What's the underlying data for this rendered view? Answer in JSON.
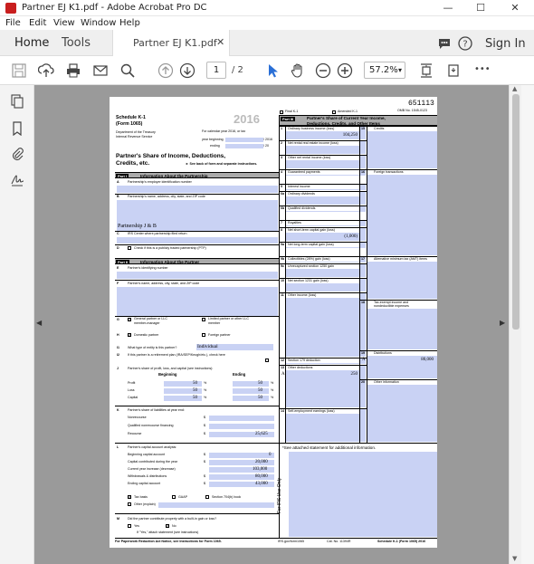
{
  "window": {
    "title": "Partner EJ K1.pdf - Adobe Acrobat Pro DC",
    "minimize": "—",
    "maximize": "☐",
    "close": "✕"
  },
  "menu": {
    "file": "File",
    "edit": "Edit",
    "view": "View",
    "window": "Window",
    "help": "Help"
  },
  "tabs": {
    "home": "Home",
    "tools": "Tools",
    "document": "Partner EJ K1.pdf",
    "document_close": "✕",
    "signin": "Sign In"
  },
  "toolbar": {
    "page_current": "1",
    "page_total": "/ 2",
    "zoom": "57.2%",
    "zoom_arrow": "▾",
    "more": "•••"
  },
  "icons": {
    "app": "acrobat-icon",
    "save": "save-icon",
    "upload": "upload-icon",
    "print": "print-icon",
    "mail": "mail-icon",
    "search": "search-icon",
    "prev": "arrow-up-icon",
    "next": "arrow-down-icon",
    "select": "cursor-icon",
    "hand": "hand-icon",
    "zoom_out": "minus-circle-icon",
    "zoom_in": "plus-circle-icon"
  },
  "form": {
    "final_k1": "Final K-1",
    "amended_k1": "Amended K-1",
    "code": "651113",
    "omb": "OMB No. 1545-0123",
    "schedule": "Schedule K-1",
    "form_num": "(Form 1065)",
    "year": "2016",
    "dept": "Department of the Treasury",
    "irs": "Internal Revenue Service",
    "cal_year": "For calendar year 2016, or tax",
    "year_beginning": "year beginning",
    "yb_suffix": "/ 2016",
    "ending": "ending",
    "end_suffix": "/ 20",
    "share_title1": "Partner's Share of Income, Deductions,",
    "share_title2": "Credits, etc.",
    "see_back": "► See back of form and separate instructions.",
    "part1_label": "Part I",
    "part1_title": "Information About the Partnership",
    "A": "A",
    "A_text": "Partnership's employer identification number",
    "B": "B",
    "B_text": "Partnership's name, address, city, state, and ZIP code",
    "B_value": "Partnership J & B",
    "C": "C",
    "C_text": "IRS Center where partnership filed return",
    "D": "D",
    "D_text": "Check if this is a publicly traded partnership (PTP)",
    "part2_label": "Part II",
    "part2_title": "Information About the Partner",
    "E": "E",
    "E_text": "Partner's identifying number",
    "F": "F",
    "F_text": "Partner's name, address, city, state, and ZIP code",
    "G": "G",
    "G_opt1a": "General partner or LLC",
    "G_opt1b": "member-manager",
    "G_opt2a": "Limited partner or other LLC",
    "G_opt2b": "member",
    "H": "H",
    "H_opt1": "Domestic partner",
    "H_opt2": "Foreign partner",
    "I1": "I1",
    "I1_text": "What type of entity is this partner?",
    "I1_value": "Individual",
    "I2": "I2",
    "I2_text": "If this partner is a retirement plan (IRA/SEP/Keogh/etc.), check here",
    "J": "J",
    "J_text": "Partner's share of profit, loss, and capital (see instructions):",
    "J_beg": "Beginning",
    "J_end": "Ending",
    "profit": "Profit",
    "loss": "Loss",
    "capital": "Capital",
    "pct": "%",
    "profit_beg": "50",
    "profit_end": "50",
    "loss_beg": "50",
    "loss_end": "50",
    "capital_beg": "50",
    "capital_end": "50",
    "K": "K",
    "K_text": "Partner's share of liabilities at year end:",
    "nonrecourse": "Nonrecourse",
    "qnf": "Qualified nonrecourse financing",
    "recourse": "Recourse",
    "dollar": "$",
    "recourse_value": "25,625",
    "L": "L",
    "L_text": "Partner's capital account analysis:",
    "L_beg": "Beginning capital account",
    "L_contrib": "Capital contributed during the year",
    "L_incr": "Current year increase (decrease)",
    "L_withdraw": "Withdrawals & distributions",
    "L_end": "Ending capital account",
    "L_beg_val": "0",
    "L_contrib_val": "20,000",
    "L_incr_val": "103,000",
    "L_withdraw_val": "80,000",
    "L_end_val": "43,000",
    "tax_basis": "Tax basis",
    "gaap": "GAAP",
    "sec704b": "Section 704(b) book",
    "other_explain": "Other (explain)",
    "M": "M",
    "M_text": "Did the partner contribute property with a built-in gain or loss?",
    "M_yes": "Yes",
    "M_no": "No",
    "M_note": "If \"Yes,\" attach statement (see instructions)",
    "footer_left": "For Paperwork Reduction Act Notice, see Instructions for Form 1065.",
    "footer_url": "IRS.gov/form1065",
    "footer_cat": "Cat. No. 11394R",
    "footer_right": "Schedule K-1 (Form 1065) 2016",
    "part3_label": "Part III",
    "part3_title1": "Partner's Share of Current Year Income,",
    "part3_title2": "Deductions, Credits, and Other Items",
    "l1": "1",
    "l1_text": "Ordinary business income (loss)",
    "l1_val": "104,250",
    "l2": "2",
    "l2_text": "Net rental real estate income (loss)",
    "l3": "3",
    "l3_text": "Other net rental income (loss)",
    "l4": "4",
    "l4_text": "Guaranteed payments",
    "l5": "5",
    "l5_text": "Interest income",
    "l6a": "6a",
    "l6a_text": "Ordinary dividends",
    "l6b": "6b",
    "l6b_text": "Qualified dividends",
    "l7": "7",
    "l7_text": "Royalties",
    "l8": "8",
    "l8_text": "Net short-term capital gain (loss)",
    "l8_val": "(1,000)",
    "l9a": "9a",
    "l9a_text": "Net long-term capital gain (loss)",
    "l9b": "9b",
    "l9b_text": "Collectibles (28%) gain (loss)",
    "l9c": "9c",
    "l9c_text": "Unrecaptured section 1250 gain",
    "l10": "10",
    "l10_text": "Net section 1231 gain (loss)",
    "l11": "11",
    "l11_text": "Other income (loss)",
    "l12": "12",
    "l12_text": "Section 179 deduction",
    "l13": "13",
    "l13_text": "Other deductions",
    "l13_code": "A",
    "l13_val": "250",
    "l14": "14",
    "l14_text": "Self-employment earnings (loss)",
    "l15": "15",
    "l15_text": "Credits",
    "l16": "16",
    "l16_text": "Foreign transactions",
    "l17": "17",
    "l17_text": "Alternative minimum tax (AMT) items",
    "l18": "18",
    "l18_text1": "Tax-exempt income and",
    "l18_text2": "nondeductible expenses",
    "l19": "19",
    "l19_text": "Distributions",
    "l19_code": "A",
    "l19_val": "80,000",
    "l20": "20",
    "l20_text": "Other information",
    "attached": "*See attached statement for additional information.",
    "irs_use": "For IRS Use Only",
    "x": "X"
  }
}
